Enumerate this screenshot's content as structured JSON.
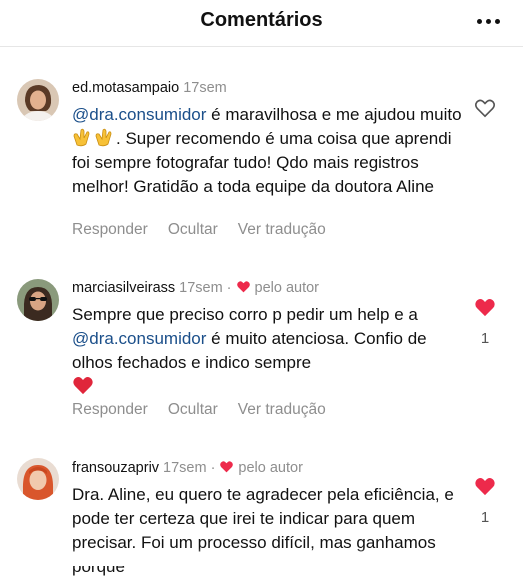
{
  "header": {
    "title": "Comentários",
    "more_icon": "more-horizontal-icon"
  },
  "comments": [
    {
      "username": "ed.motasampaio",
      "time": "17sem",
      "mention": "@dra.consumidor",
      "text_after_mention": " é maravilhosa e me ajudou muito",
      "text_rest": ". Super recomendo é uma coisa que aprendi foi sempre fotografar tudo! Qdo mais registros melhor! Gratidão a toda equipe da doutora Aline",
      "emoji": "clapping-hands-icon",
      "liked": false,
      "actions": {
        "reply": "Responder",
        "hide": "Ocultar",
        "translate": "Ver tradução"
      }
    },
    {
      "username": "marciasilveirass",
      "time": "17sem",
      "author_badge": "pelo autor",
      "text_before_mention": "Sempre que preciso corro p pedir um help e a ",
      "mention": "@dra.consumidor",
      "text_after_mention": " é muito atenciosa. Confio de olhos fechados e indico sempre",
      "emoji": "red-heart-icon",
      "liked": true,
      "like_count": "1",
      "actions": {
        "reply": "Responder",
        "hide": "Ocultar",
        "translate": "Ver tradução"
      }
    },
    {
      "username": "fransouzapriv",
      "time": "17sem",
      "author_badge": "pelo autor",
      "text": "Dra. Aline, eu quero te agradecer pela eficiência, e pode ter certeza que irei te indicar para quem precisar. Foi um processo difícil, mas ganhamos porque",
      "liked": true,
      "like_count": "1"
    }
  ],
  "colors": {
    "heart_red": "#ed2a4b",
    "mention_blue": "#1b4f8a",
    "muted_gray": "#8e8e8e"
  }
}
